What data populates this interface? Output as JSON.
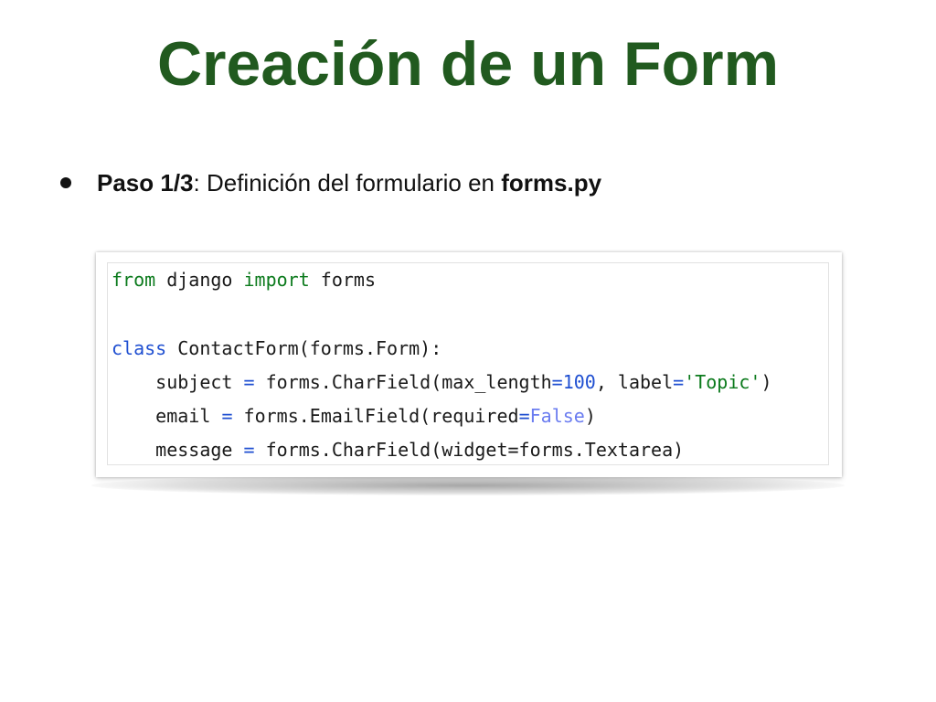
{
  "slide": {
    "title": "Creación de un Form",
    "bullet": {
      "step_label": "Paso 1/3",
      "colon": ":",
      "middle_text": " Definición del formulario en ",
      "filename": "forms.py"
    }
  },
  "code": {
    "line1": {
      "kw_from": "from",
      "module": " django ",
      "kw_import": "import",
      "name": " forms"
    },
    "line3": {
      "kw_class": "class",
      "rest": " ContactForm(forms.Form):"
    },
    "line4": {
      "indent": "    ",
      "var": "subject",
      "sp1": " ",
      "eq1": "=",
      "call": " forms.CharField(max_length",
      "eq2": "=",
      "num": "100",
      "mid": ", label",
      "eq3": "=",
      "str": "'Topic'",
      "end": ")"
    },
    "line5": {
      "indent": "    ",
      "var": "email",
      "sp1": " ",
      "eq1": "=",
      "call": " forms.EmailField(required",
      "eq2": "=",
      "bool": "False",
      "end": ")"
    },
    "line6": {
      "indent": "    ",
      "var": "message",
      "sp1": " ",
      "eq1": "=",
      "rest": " forms.CharField(widget=forms.Textarea)"
    }
  },
  "colors": {
    "title": "#215a1f",
    "keyword_green": "#0b7a1c",
    "keyword_blue": "#1f4fd1",
    "boolean": "#6a7cf0"
  }
}
